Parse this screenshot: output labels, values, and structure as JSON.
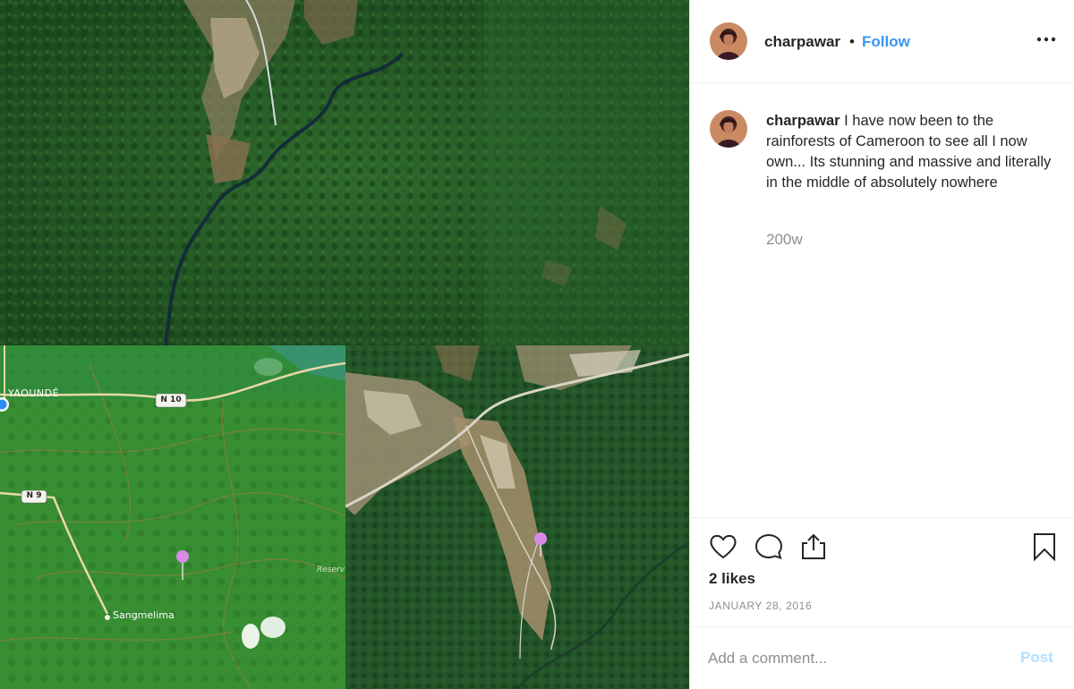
{
  "post": {
    "username": "charpawar",
    "separator": "•",
    "follow_label": "Follow",
    "caption_text": "I have now been to the rainforests of Cameroon to see all I now own... Its stunning and massive and literally in the middle of absolutely nowhere",
    "age": "200w",
    "likes": "2 likes",
    "date": "JANUARY 28, 2016"
  },
  "media": {
    "map_labels": {
      "city1": "YAOUNDÉ",
      "road1": "N 10",
      "road2": "N 9",
      "city2": "Sangmelima",
      "reserve": "Reserv"
    }
  },
  "comment_box": {
    "placeholder": "Add a comment...",
    "post_label": "Post"
  },
  "icons": [
    "more-options-icon",
    "heart-icon",
    "comment-icon",
    "share-icon",
    "bookmark-icon",
    "map-pin-icon"
  ],
  "colors": {
    "accent": "#3897f0",
    "post_disabled": "#b2dffc",
    "muted": "#8e8e8e",
    "forest": "#1e4a22"
  }
}
